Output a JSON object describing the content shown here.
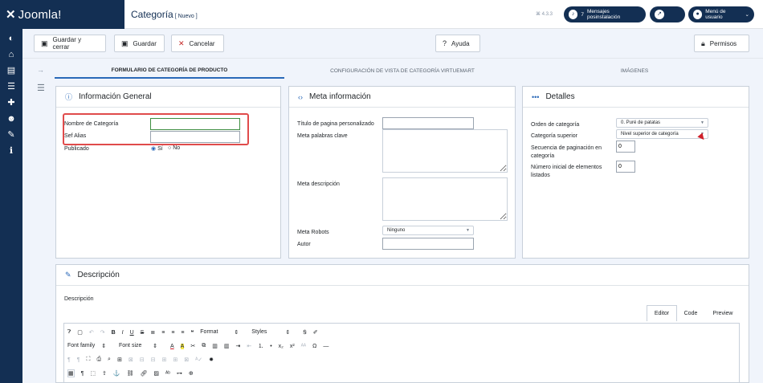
{
  "app": {
    "logo_mark": "✕",
    "logo_text": "Joomla!"
  },
  "header": {
    "title": "Categoría",
    "title_suffix": "[ Nuevo ]",
    "version": "⌘ 4.3.3",
    "notifications": {
      "count": "7",
      "label": "Mensajes posinstalación"
    },
    "user_menu": "Menú de usuario"
  },
  "toolbar": {
    "save_close": "Guardar y cerrar",
    "save": "Guardar",
    "cancel": "Cancelar",
    "help": "Ayuda",
    "permissions": "Permisos"
  },
  "tabs": [
    {
      "label": "FORMULARIO DE CATEGORÍA DE PRODUCTO"
    },
    {
      "label": "CONFIGURACIÓN DE VISTA DE CATEGORÍA VIRTUEMART"
    },
    {
      "label": "IMÁGENES"
    }
  ],
  "general": {
    "heading": "Información General",
    "category_name_label": "Nombre de Categoría",
    "category_name_value": "",
    "alias_label": "Sef Alias",
    "alias_value": "",
    "published_label": "Publicado",
    "published_yes": "Sí",
    "published_no": "No"
  },
  "meta": {
    "heading": "Meta información",
    "page_title_label": "Título de pagina personalizado",
    "keywords_label": "Meta palabras clave",
    "description_label": "Meta descripción",
    "robots_label": "Meta Robots",
    "robots_value": "Ninguno",
    "author_label": "Autor"
  },
  "details": {
    "heading": "Detalles",
    "order_label": "Orden de categoría",
    "order_value": "0. Puré de patatas",
    "parent_label": "Categoría superior",
    "parent_value": "Nivel superior de categoría",
    "pagination_label": "Secuencia de paginación en categoría",
    "pagination_value": "0",
    "initial_label": "Número inicial de elementos listados",
    "initial_value": "0"
  },
  "description": {
    "heading": "Descripción",
    "field_label": "Descripción",
    "editor_tabs": [
      "Editor",
      "Code",
      "Preview"
    ],
    "format_select": "Format",
    "styles_select": "Styles",
    "font_family_select": "Font family",
    "font_size_select": "Font size"
  }
}
